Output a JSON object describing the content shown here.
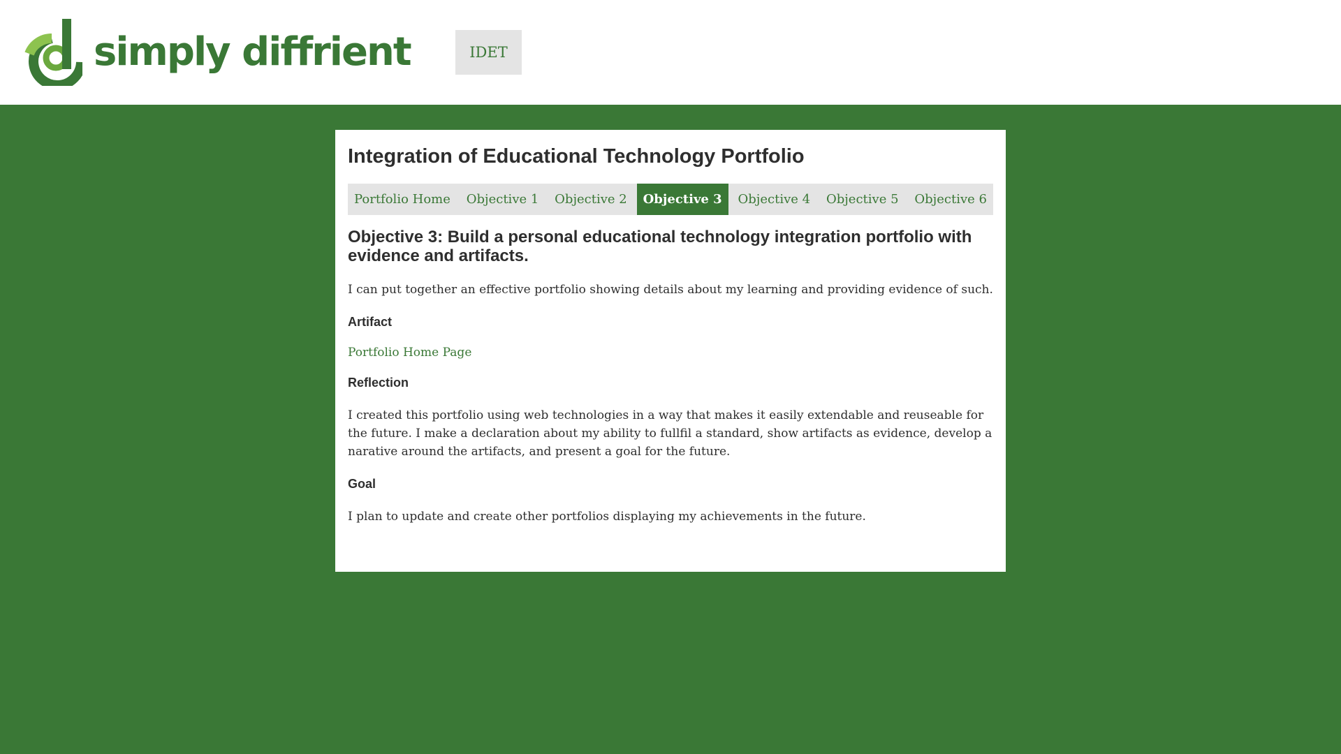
{
  "header": {
    "logo_text": "simply diffrient",
    "logo_icon": "d-logo-icon",
    "idet_label": "IDET"
  },
  "card": {
    "title": "Integration of Educational Technology Portfolio",
    "tabs": [
      {
        "label": "Portfolio Home",
        "active": false
      },
      {
        "label": "Objective 1",
        "active": false
      },
      {
        "label": "Objective 2",
        "active": false
      },
      {
        "label": "Objective 3",
        "active": true
      },
      {
        "label": "Objective 4",
        "active": false
      },
      {
        "label": "Objective 5",
        "active": false
      },
      {
        "label": "Objective 6",
        "active": false
      }
    ],
    "objective_heading": "Objective 3: Build a personal educational technology integration portfolio with evidence and artifacts.",
    "intro": "I can put together an effective portfolio showing details about my learning and providing evidence of such.",
    "artifact_heading": "Artifact",
    "artifact_link": "Portfolio Home Page",
    "reflection_heading": "Reflection",
    "reflection_text": "I created this portfolio using web technologies in a way that makes it easily extendable and reuseable for the future. I make a declaration about my ability to fullfil a standard, show artifacts as evidence, develop a narative around the artifacts, and present a goal for the future.",
    "goal_heading": "Goal",
    "goal_text": "I plan to update and create other portfolios displaying my achievements in the future."
  },
  "colors": {
    "brand_green": "#3a7836",
    "tab_bg": "#e4e4e4",
    "text": "#2e2e2e"
  }
}
